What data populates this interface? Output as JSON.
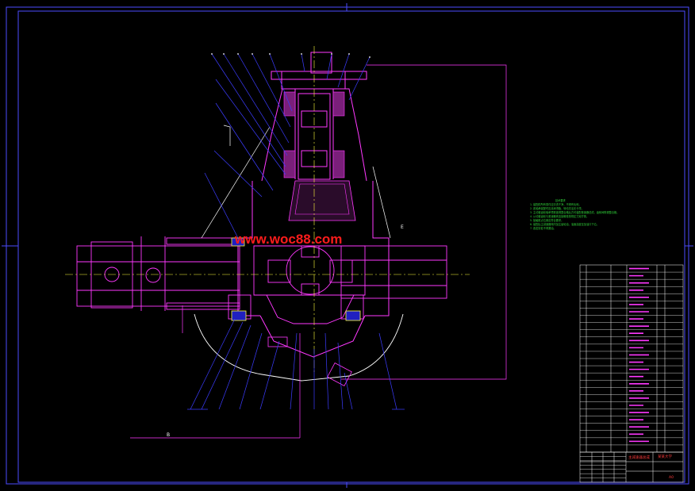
{
  "drawing": {
    "watermark": "www.woc88.com",
    "datum_mark": "E",
    "dimension_label": "B",
    "notes_title": "技术要求",
    "notes": [
      "1. 装配前所有零件应清洗干净，不得有毛刺。",
      "2. 各轴承装配时应涂润滑脂，转动灵活无卡滞。",
      "3. 主动锥齿轮轴承预紧度调整合格后方可装配差速器总成，齿侧间隙调整合格。",
      "4. 从动锥齿轮与差速器壳连接螺栓按规定力矩拧紧。",
      "5. 接触斑点位置应符合要求。",
      "6. 装配后主减速器壳内加注齿轮油，油面高度至加油口下沿。",
      "7. 各密封处不得漏油。"
    ],
    "title_block": {
      "drawing_name": "主减速器总成",
      "school": "某某大学",
      "sheet": "A0"
    },
    "colors": {
      "background": "#000000",
      "frame": "#4b4bff",
      "part": "#ff38ff",
      "leader": "#3c3cff",
      "centerline": "#ffff3c",
      "section": "#ffffff",
      "notes": "#31d23a",
      "title": "#ff3b3b"
    }
  }
}
